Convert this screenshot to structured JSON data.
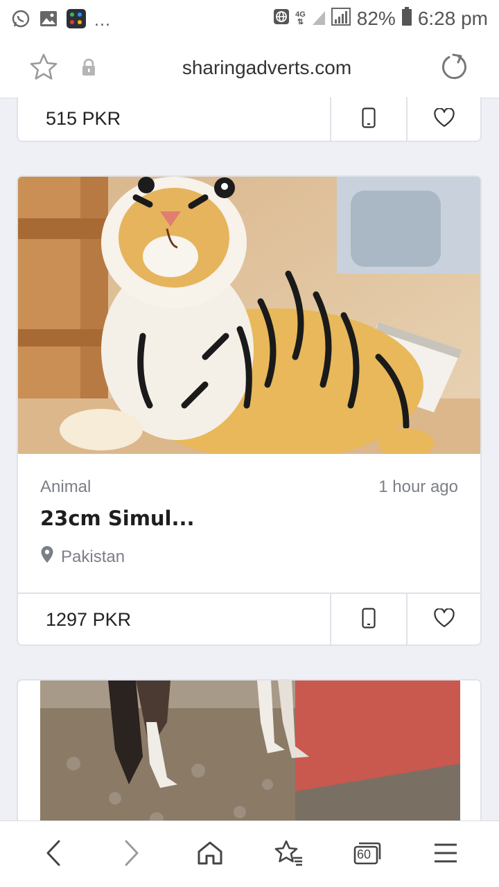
{
  "status_bar": {
    "network": "4G",
    "battery": "82%",
    "time": "6:28 pm",
    "more": "...",
    "icons": [
      "whatsapp-icon",
      "gallery-icon",
      "app-grid-icon",
      "globe-icon",
      "signal-icon",
      "battery-icon"
    ]
  },
  "browser": {
    "url": "sharingadverts.com",
    "icons": [
      "star-icon",
      "lock-icon",
      "reload-icon"
    ]
  },
  "listings": [
    {
      "price": "515 PKR"
    },
    {
      "category": "Animal",
      "time_ago": "1 hour ago",
      "title": "23cm Simul...",
      "location": "Pakistan",
      "price": "1297 PKR"
    }
  ],
  "bottom_nav": {
    "tab_count": "60",
    "icons": [
      "back-icon",
      "forward-icon",
      "home-icon",
      "bookmarks-icon",
      "tabs-icon",
      "menu-icon"
    ]
  },
  "colors": {
    "background": "#eef0f5",
    "card_border": "#dfe2e8",
    "muted_text": "#7b7f86"
  }
}
